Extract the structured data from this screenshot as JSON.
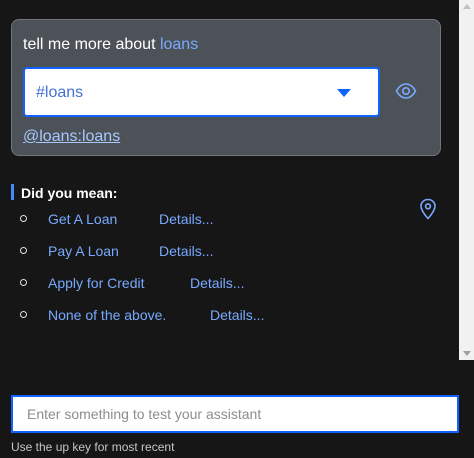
{
  "card": {
    "title_prefix": "tell me more about ",
    "title_keyword": "loans",
    "select_value": "#loans",
    "entity_link": "@loans:loans"
  },
  "suggestions": {
    "heading": "Did you mean:",
    "options": [
      {
        "label": "Get A Loan",
        "details": "Details..."
      },
      {
        "label": "Pay A Loan",
        "details": "Details..."
      },
      {
        "label": "Apply for Credit",
        "details": "Details..."
      },
      {
        "label": "None of the above.",
        "details": "Details..."
      }
    ]
  },
  "composer": {
    "placeholder": "Enter something to test your assistant",
    "value": "",
    "helper": "Use the up key for most recent"
  },
  "icons": {
    "eye": "eye-icon",
    "location": "location-pin-icon",
    "caret": "caret-down-icon"
  },
  "colors": {
    "background": "#161616",
    "card": "#4d5258",
    "accent": "#0f62fe",
    "link": "#78a9ff"
  }
}
